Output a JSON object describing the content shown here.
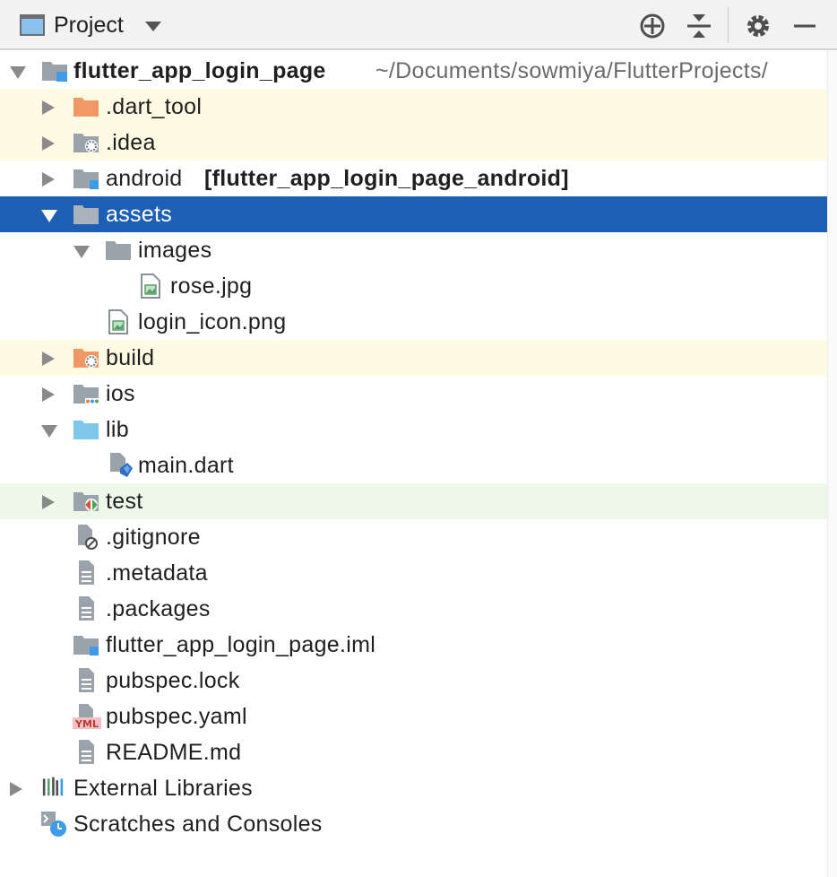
{
  "toolbar": {
    "title": "Project",
    "view_icon": "project-view-icon",
    "buttons": [
      "locate-icon",
      "collapse-all-icon",
      "gear-icon",
      "minimize-icon"
    ]
  },
  "tree": {
    "root": {
      "name": "flutter_app_login_page",
      "path": "~/Documents/sowmiya/FlutterProjects/"
    },
    "items": [
      {
        "label": ".dart_tool"
      },
      {
        "label": ".idea"
      },
      {
        "label": "android",
        "suffix": "[flutter_app_login_page_android]"
      },
      {
        "label": "assets"
      },
      {
        "label": "images"
      },
      {
        "label": "rose.jpg"
      },
      {
        "label": "login_icon.png"
      },
      {
        "label": "build"
      },
      {
        "label": "ios"
      },
      {
        "label": "lib"
      },
      {
        "label": "main.dart"
      },
      {
        "label": "test"
      },
      {
        "label": ".gitignore"
      },
      {
        "label": ".metadata"
      },
      {
        "label": ".packages"
      },
      {
        "label": "flutter_app_login_page.iml"
      },
      {
        "label": "pubspec.lock"
      },
      {
        "label": "pubspec.yaml"
      },
      {
        "label": "README.md"
      }
    ],
    "external_libraries": "External Libraries",
    "scratches": "Scratches and Consoles"
  },
  "colors": {
    "selection": "#1c5fb4",
    "excluded_row": "#fdfbe4",
    "test_row": "#eef8e9",
    "folder_gray": "#9aa3ab",
    "folder_orange": "#f29866",
    "folder_blue": "#7ec6ea",
    "module_badge": "#3d9be9"
  }
}
